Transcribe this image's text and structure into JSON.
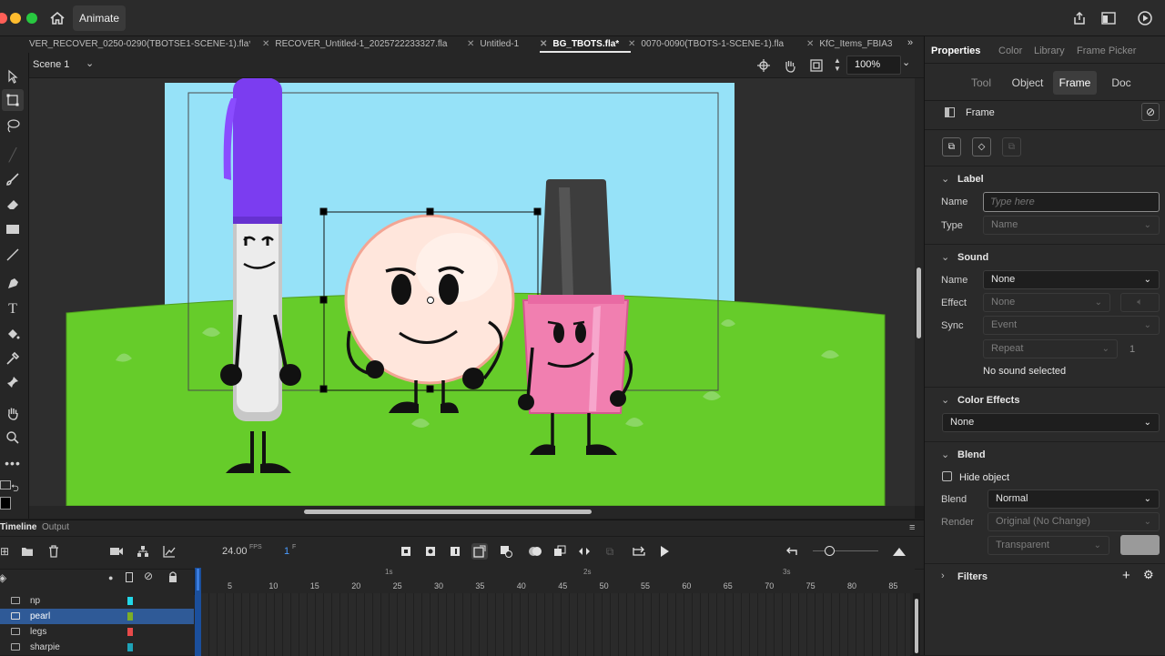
{
  "app": {
    "name": "Animate",
    "header_icons": [
      "home-icon",
      "share-icon",
      "window-icon",
      "play-circle-icon"
    ]
  },
  "doc_tabs": [
    {
      "label": "VER_RECOVER_0250-0290(TBOTSE1-SCENE-1).fla*",
      "active": false
    },
    {
      "label": "RECOVER_Untitled-1_2025722233327.fla",
      "active": false
    },
    {
      "label": "Untitled-1",
      "active": false
    },
    {
      "label": "BG_TBOTS.fla*",
      "active": true
    },
    {
      "label": "0070-0090(TBOTS-1-SCENE-1).fla",
      "active": false
    },
    {
      "label": "KfC_Items_FBIA3",
      "active": false
    }
  ],
  "stage": {
    "scene": "Scene 1",
    "zoom": "100%"
  },
  "colors": {
    "accent": "#1473e6",
    "sky": "#96e2f8",
    "grass": "#66cc2a",
    "marker": "#7b3df0",
    "polish": "#f17fb0",
    "pearl": "#ffe6dc"
  },
  "properties": {
    "tabs": [
      "Properties",
      "Color",
      "Library",
      "Frame Picker"
    ],
    "segments": [
      "Tool",
      "Object",
      "Frame",
      "Doc"
    ],
    "active_segment": "Frame",
    "panel_title": "Frame",
    "label_section": {
      "title": "Label",
      "name_label": "Name",
      "name_placeholder": "Type here",
      "type_label": "Type",
      "type_value": "Name"
    },
    "sound_section": {
      "title": "Sound",
      "name_label": "Name",
      "name_value": "None",
      "effect_label": "Effect",
      "effect_value": "None",
      "sync_label": "Sync",
      "sync_value": "Event",
      "repeat_value": "Repeat",
      "repeat_count": "1",
      "status": "No sound selected"
    },
    "color_effects": {
      "title": "Color Effects",
      "value": "None"
    },
    "blend_section": {
      "title": "Blend",
      "hide_object": "Hide object",
      "blend_label": "Blend",
      "blend_value": "Normal",
      "render_label": "Render",
      "render_value": "Original (No Change)",
      "transparent_value": "Transparent"
    },
    "filters": {
      "title": "Filters"
    }
  },
  "timeline": {
    "tabs": [
      "Timeline",
      "Output"
    ],
    "fps": "24.00",
    "fps_unit": "FPS",
    "frame": "1",
    "frame_unit": "F",
    "seconds": [
      "1s",
      "2s",
      "3s"
    ],
    "frame_numbers": [
      "5",
      "10",
      "15",
      "20",
      "25",
      "30",
      "35",
      "40",
      "45",
      "50",
      "55",
      "60",
      "65",
      "70",
      "75",
      "80",
      "85"
    ],
    "layers": [
      {
        "name": "np",
        "color": "#22d7e8",
        "selected": false
      },
      {
        "name": "pearl",
        "color": "#7cae27",
        "selected": true
      },
      {
        "name": "legs",
        "color": "#e84a4a",
        "selected": false
      },
      {
        "name": "sharpie",
        "color": "#1ea3b8",
        "selected": false
      }
    ]
  }
}
